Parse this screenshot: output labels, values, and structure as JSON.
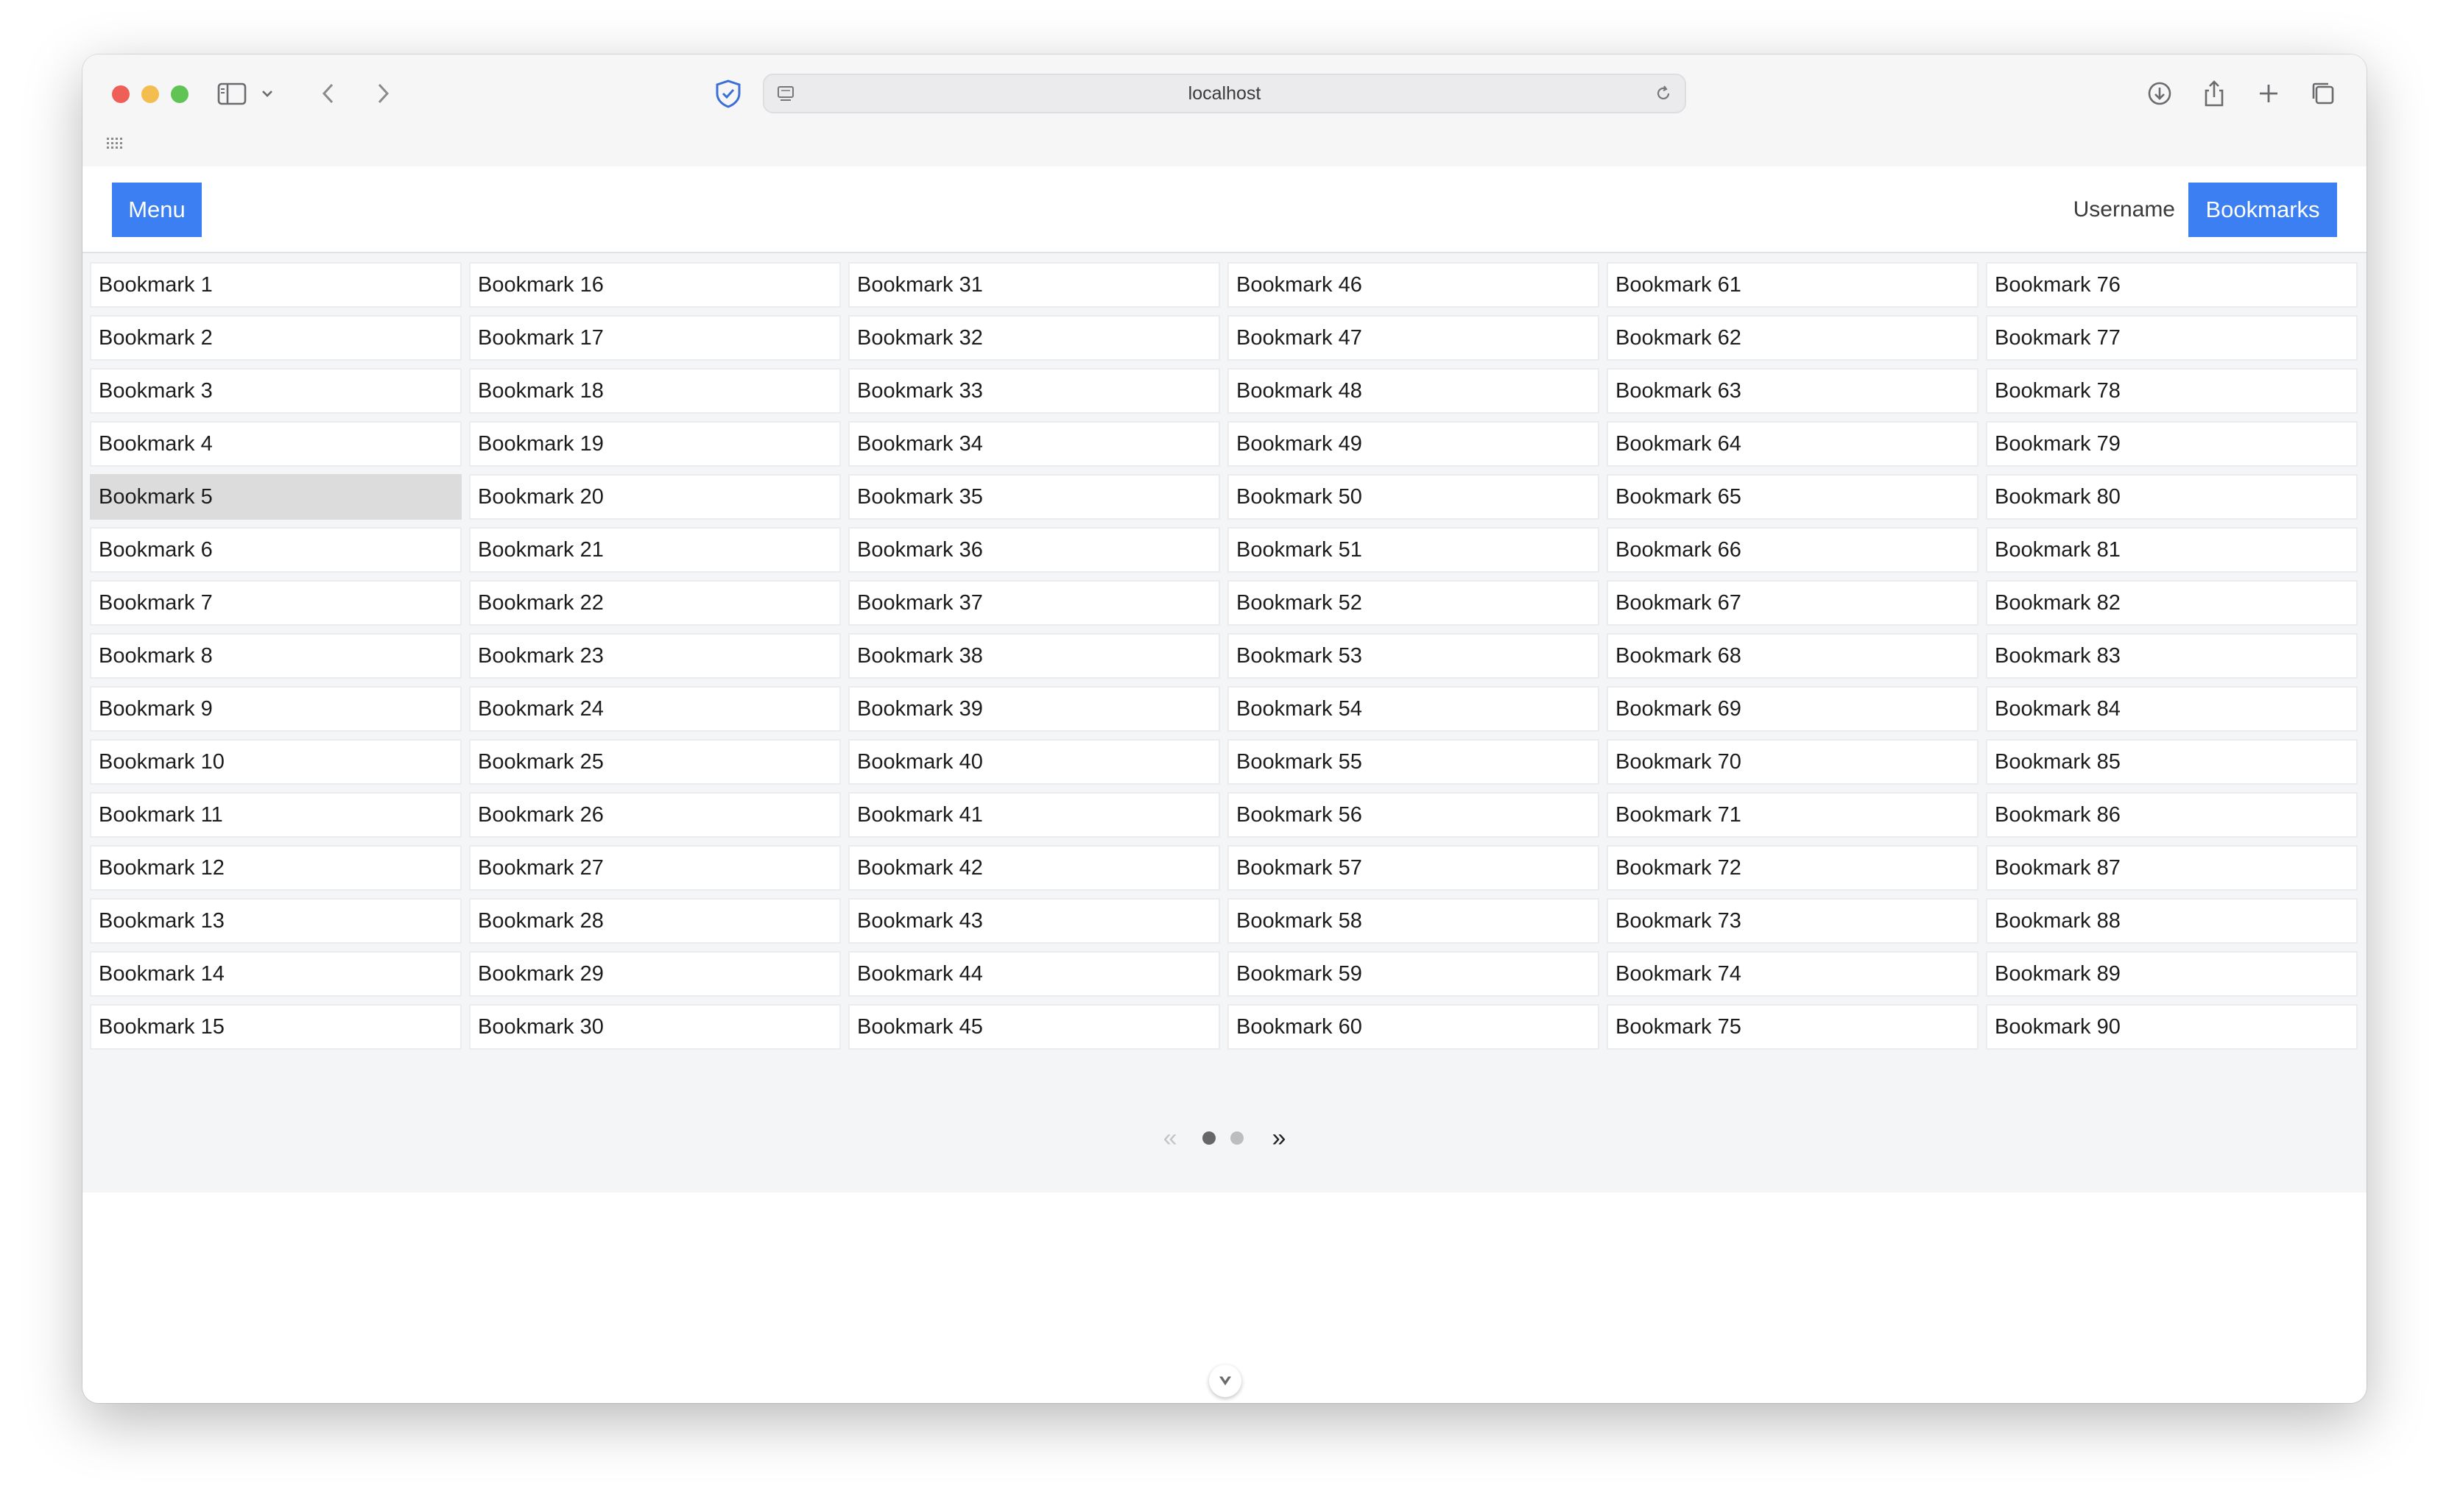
{
  "browser": {
    "url": "localhost",
    "icons": [
      "sidebar-icon",
      "chevron-down-icon",
      "back-icon",
      "forward-icon",
      "shield-icon",
      "reload-icon",
      "download-icon",
      "share-icon",
      "plus-icon",
      "tabs-icon",
      "grid-icon"
    ]
  },
  "header": {
    "menu_label": "Menu",
    "username": "Username",
    "bookmarks_label": "Bookmarks",
    "accent_color": "#3b7ff2"
  },
  "bookmarks": [
    "Bookmark 1",
    "Bookmark 2",
    "Bookmark 3",
    "Bookmark 4",
    "Bookmark 5",
    "Bookmark 6",
    "Bookmark 7",
    "Bookmark 8",
    "Bookmark 9",
    "Bookmark 10",
    "Bookmark 11",
    "Bookmark 12",
    "Bookmark 13",
    "Bookmark 14",
    "Bookmark 15",
    "Bookmark 16",
    "Bookmark 17",
    "Bookmark 18",
    "Bookmark 19",
    "Bookmark 20",
    "Bookmark 21",
    "Bookmark 22",
    "Bookmark 23",
    "Bookmark 24",
    "Bookmark 25",
    "Bookmark 26",
    "Bookmark 27",
    "Bookmark 28",
    "Bookmark 29",
    "Bookmark 30",
    "Bookmark 31",
    "Bookmark 32",
    "Bookmark 33",
    "Bookmark 34",
    "Bookmark 35",
    "Bookmark 36",
    "Bookmark 37",
    "Bookmark 38",
    "Bookmark 39",
    "Bookmark 40",
    "Bookmark 41",
    "Bookmark 42",
    "Bookmark 43",
    "Bookmark 44",
    "Bookmark 45",
    "Bookmark 46",
    "Bookmark 47",
    "Bookmark 48",
    "Bookmark 49",
    "Bookmark 50",
    "Bookmark 51",
    "Bookmark 52",
    "Bookmark 53",
    "Bookmark 54",
    "Bookmark 55",
    "Bookmark 56",
    "Bookmark 57",
    "Bookmark 58",
    "Bookmark 59",
    "Bookmark 60",
    "Bookmark 61",
    "Bookmark 62",
    "Bookmark 63",
    "Bookmark 64",
    "Bookmark 65",
    "Bookmark 66",
    "Bookmark 67",
    "Bookmark 68",
    "Bookmark 69",
    "Bookmark 70",
    "Bookmark 71",
    "Bookmark 72",
    "Bookmark 73",
    "Bookmark 74",
    "Bookmark 75",
    "Bookmark 76",
    "Bookmark 77",
    "Bookmark 78",
    "Bookmark 79",
    "Bookmark 80",
    "Bookmark 81",
    "Bookmark 82",
    "Bookmark 83",
    "Bookmark 84",
    "Bookmark 85",
    "Bookmark 86",
    "Bookmark 87",
    "Bookmark 88",
    "Bookmark 89",
    "Bookmark 90"
  ],
  "selected_bookmark": "Bookmark 5",
  "pagination": {
    "prev_symbol": "«",
    "next_symbol": "»",
    "page_count": 2,
    "current_page": 1
  }
}
